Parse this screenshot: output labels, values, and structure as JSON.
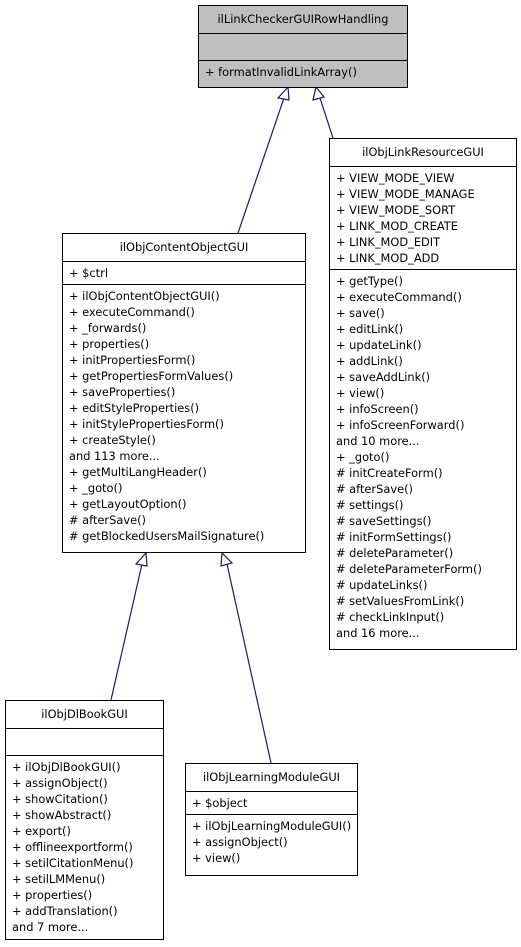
{
  "diagram": {
    "type": "class-inheritance",
    "classes": {
      "base": {
        "name": "ilLinkCheckerGUIRowHandling",
        "attributes": [],
        "methods": [
          "+ formatInvalidLinkArray()"
        ],
        "highlighted": true,
        "fill": "#bfbfbf"
      },
      "link_resource": {
        "name": "ilObjLinkResourceGUI",
        "attributes": [
          "+ VIEW_MODE_VIEW",
          "+ VIEW_MODE_MANAGE",
          "+ VIEW_MODE_SORT",
          "+ LINK_MOD_CREATE",
          "+ LINK_MOD_EDIT",
          "+ LINK_MOD_ADD"
        ],
        "methods": [
          "+ getType()",
          "+ executeCommand()",
          "+ save()",
          "+ editLink()",
          "+ updateLink()",
          "+ addLink()",
          "+ saveAddLink()",
          "+ view()",
          "+ infoScreen()",
          "+ infoScreenForward()",
          "and 10 more...",
          "+ _goto()",
          "# initCreateForm()",
          "# afterSave()",
          "# settings()",
          "# saveSettings()",
          "# initFormSettings()",
          "# deleteParameter()",
          "# deleteParameterForm()",
          "# updateLinks()",
          "# setValuesFromLink()",
          "# checkLinkInput()",
          "and 16 more..."
        ]
      },
      "content_object": {
        "name": "ilObjContentObjectGUI",
        "attributes": [
          "+ $ctrl"
        ],
        "methods": [
          "+ ilObjContentObjectGUI()",
          "+ executeCommand()",
          "+ _forwards()",
          "+ properties()",
          "+ initPropertiesForm()",
          "+ getPropertiesFormValues()",
          "+ saveProperties()",
          "+ editStyleProperties()",
          "+ initStylePropertiesForm()",
          "+ createStyle()",
          "and 113 more...",
          "+ getMultiLangHeader()",
          "+ _goto()",
          "+ getLayoutOption()",
          "# afterSave()",
          "# getBlockedUsersMailSignature()"
        ]
      },
      "dl_book": {
        "name": "ilObjDlBookGUI",
        "attributes": [],
        "methods": [
          "+ ilObjDlBookGUI()",
          "+ assignObject()",
          "+ showCitation()",
          "+ showAbstract()",
          "+ export()",
          "+ offlineexportform()",
          "+ setilCitationMenu()",
          "+ setilLMMenu()",
          "+ properties()",
          "+ addTranslation()",
          "and 7 more..."
        ]
      },
      "learning_module": {
        "name": "ilObjLearningModuleGUI",
        "attributes": [
          "+ $object"
        ],
        "methods": [
          "+ ilObjLearningModuleGUI()",
          "+ assignObject()",
          "+ view()"
        ]
      }
    },
    "edges": [
      {
        "from": "ilObjContentObjectGUI",
        "to": "ilLinkCheckerGUIRowHandling",
        "kind": "inheritance"
      },
      {
        "from": "ilObjLinkResourceGUI",
        "to": "ilLinkCheckerGUIRowHandling",
        "kind": "inheritance"
      },
      {
        "from": "ilObjDlBookGUI",
        "to": "ilObjContentObjectGUI",
        "kind": "inheritance"
      },
      {
        "from": "ilObjLearningModuleGUI",
        "to": "ilObjContentObjectGUI",
        "kind": "inheritance"
      }
    ],
    "edge_color": "#191970"
  }
}
